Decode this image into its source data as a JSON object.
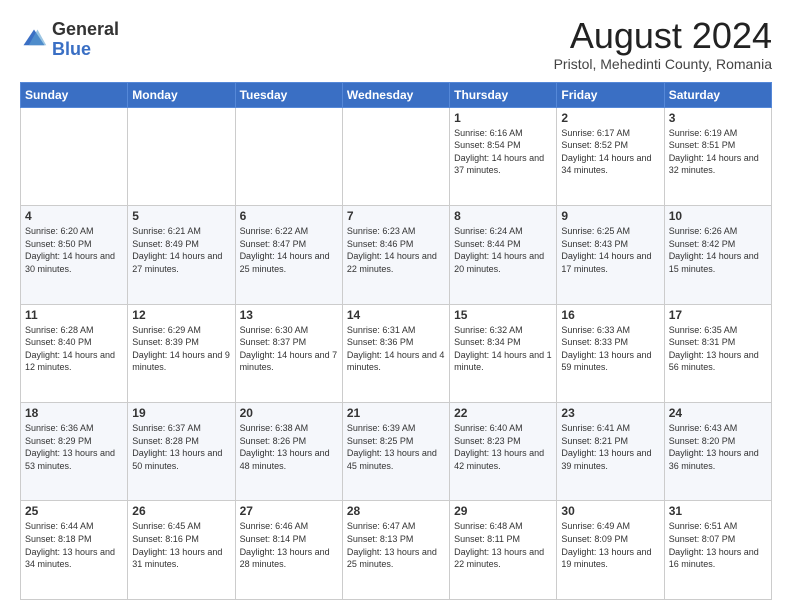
{
  "header": {
    "logo_general": "General",
    "logo_blue": "Blue",
    "month_title": "August 2024",
    "subtitle": "Pristol, Mehedinti County, Romania"
  },
  "days_of_week": [
    "Sunday",
    "Monday",
    "Tuesday",
    "Wednesday",
    "Thursday",
    "Friday",
    "Saturday"
  ],
  "weeks": [
    [
      {
        "num": "",
        "info": ""
      },
      {
        "num": "",
        "info": ""
      },
      {
        "num": "",
        "info": ""
      },
      {
        "num": "",
        "info": ""
      },
      {
        "num": "1",
        "info": "Sunrise: 6:16 AM\nSunset: 8:54 PM\nDaylight: 14 hours\nand 37 minutes."
      },
      {
        "num": "2",
        "info": "Sunrise: 6:17 AM\nSunset: 8:52 PM\nDaylight: 14 hours\nand 34 minutes."
      },
      {
        "num": "3",
        "info": "Sunrise: 6:19 AM\nSunset: 8:51 PM\nDaylight: 14 hours\nand 32 minutes."
      }
    ],
    [
      {
        "num": "4",
        "info": "Sunrise: 6:20 AM\nSunset: 8:50 PM\nDaylight: 14 hours\nand 30 minutes."
      },
      {
        "num": "5",
        "info": "Sunrise: 6:21 AM\nSunset: 8:49 PM\nDaylight: 14 hours\nand 27 minutes."
      },
      {
        "num": "6",
        "info": "Sunrise: 6:22 AM\nSunset: 8:47 PM\nDaylight: 14 hours\nand 25 minutes."
      },
      {
        "num": "7",
        "info": "Sunrise: 6:23 AM\nSunset: 8:46 PM\nDaylight: 14 hours\nand 22 minutes."
      },
      {
        "num": "8",
        "info": "Sunrise: 6:24 AM\nSunset: 8:44 PM\nDaylight: 14 hours\nand 20 minutes."
      },
      {
        "num": "9",
        "info": "Sunrise: 6:25 AM\nSunset: 8:43 PM\nDaylight: 14 hours\nand 17 minutes."
      },
      {
        "num": "10",
        "info": "Sunrise: 6:26 AM\nSunset: 8:42 PM\nDaylight: 14 hours\nand 15 minutes."
      }
    ],
    [
      {
        "num": "11",
        "info": "Sunrise: 6:28 AM\nSunset: 8:40 PM\nDaylight: 14 hours\nand 12 minutes."
      },
      {
        "num": "12",
        "info": "Sunrise: 6:29 AM\nSunset: 8:39 PM\nDaylight: 14 hours\nand 9 minutes."
      },
      {
        "num": "13",
        "info": "Sunrise: 6:30 AM\nSunset: 8:37 PM\nDaylight: 14 hours\nand 7 minutes."
      },
      {
        "num": "14",
        "info": "Sunrise: 6:31 AM\nSunset: 8:36 PM\nDaylight: 14 hours\nand 4 minutes."
      },
      {
        "num": "15",
        "info": "Sunrise: 6:32 AM\nSunset: 8:34 PM\nDaylight: 14 hours\nand 1 minute."
      },
      {
        "num": "16",
        "info": "Sunrise: 6:33 AM\nSunset: 8:33 PM\nDaylight: 13 hours\nand 59 minutes."
      },
      {
        "num": "17",
        "info": "Sunrise: 6:35 AM\nSunset: 8:31 PM\nDaylight: 13 hours\nand 56 minutes."
      }
    ],
    [
      {
        "num": "18",
        "info": "Sunrise: 6:36 AM\nSunset: 8:29 PM\nDaylight: 13 hours\nand 53 minutes."
      },
      {
        "num": "19",
        "info": "Sunrise: 6:37 AM\nSunset: 8:28 PM\nDaylight: 13 hours\nand 50 minutes."
      },
      {
        "num": "20",
        "info": "Sunrise: 6:38 AM\nSunset: 8:26 PM\nDaylight: 13 hours\nand 48 minutes."
      },
      {
        "num": "21",
        "info": "Sunrise: 6:39 AM\nSunset: 8:25 PM\nDaylight: 13 hours\nand 45 minutes."
      },
      {
        "num": "22",
        "info": "Sunrise: 6:40 AM\nSunset: 8:23 PM\nDaylight: 13 hours\nand 42 minutes."
      },
      {
        "num": "23",
        "info": "Sunrise: 6:41 AM\nSunset: 8:21 PM\nDaylight: 13 hours\nand 39 minutes."
      },
      {
        "num": "24",
        "info": "Sunrise: 6:43 AM\nSunset: 8:20 PM\nDaylight: 13 hours\nand 36 minutes."
      }
    ],
    [
      {
        "num": "25",
        "info": "Sunrise: 6:44 AM\nSunset: 8:18 PM\nDaylight: 13 hours\nand 34 minutes."
      },
      {
        "num": "26",
        "info": "Sunrise: 6:45 AM\nSunset: 8:16 PM\nDaylight: 13 hours\nand 31 minutes."
      },
      {
        "num": "27",
        "info": "Sunrise: 6:46 AM\nSunset: 8:14 PM\nDaylight: 13 hours\nand 28 minutes."
      },
      {
        "num": "28",
        "info": "Sunrise: 6:47 AM\nSunset: 8:13 PM\nDaylight: 13 hours\nand 25 minutes."
      },
      {
        "num": "29",
        "info": "Sunrise: 6:48 AM\nSunset: 8:11 PM\nDaylight: 13 hours\nand 22 minutes."
      },
      {
        "num": "30",
        "info": "Sunrise: 6:49 AM\nSunset: 8:09 PM\nDaylight: 13 hours\nand 19 minutes."
      },
      {
        "num": "31",
        "info": "Sunrise: 6:51 AM\nSunset: 8:07 PM\nDaylight: 13 hours\nand 16 minutes."
      }
    ]
  ]
}
